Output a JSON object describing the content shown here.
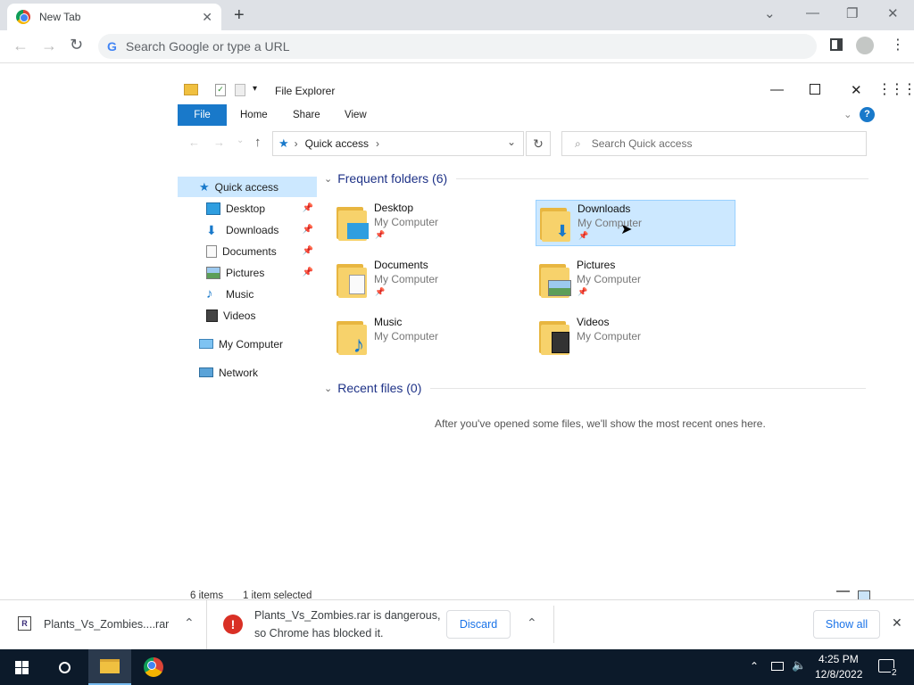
{
  "browser": {
    "tab_title": "New Tab",
    "omnibox_placeholder": "Search Google or type a URL",
    "icons": [
      "chrome-icon",
      "close-icon",
      "new-tab-icon",
      "back-icon",
      "forward-icon",
      "reload-icon",
      "google-icon",
      "sidepanel-icon",
      "profile-icon",
      "menu-icon"
    ]
  },
  "explorer": {
    "title": "File Explorer",
    "ribbon": {
      "file": "File",
      "home": "Home",
      "share": "Share",
      "view": "View"
    },
    "address": {
      "crumb": "Quick access"
    },
    "search_placeholder": "Search Quick access",
    "nav": [
      {
        "label": "Quick access",
        "pinned": false,
        "icon": "star-icon"
      },
      {
        "label": "Desktop",
        "pinned": true,
        "icon": "desktop-icon"
      },
      {
        "label": "Downloads",
        "pinned": true,
        "icon": "download-icon"
      },
      {
        "label": "Documents",
        "pinned": true,
        "icon": "document-icon"
      },
      {
        "label": "Pictures",
        "pinned": true,
        "icon": "picture-icon"
      },
      {
        "label": "Music",
        "pinned": false,
        "icon": "music-icon"
      },
      {
        "label": "Videos",
        "pinned": false,
        "icon": "video-icon"
      },
      {
        "label": "My Computer",
        "pinned": false,
        "icon": "computer-icon"
      },
      {
        "label": "Network",
        "pinned": false,
        "icon": "network-icon"
      }
    ],
    "frequent_header": "Frequent folders (6)",
    "folders": [
      {
        "name": "Desktop",
        "location": "My Computer",
        "pinned": true,
        "selected": false
      },
      {
        "name": "Downloads",
        "location": "My Computer",
        "pinned": true,
        "selected": true
      },
      {
        "name": "Documents",
        "location": "My Computer",
        "pinned": true,
        "selected": false
      },
      {
        "name": "Pictures",
        "location": "My Computer",
        "pinned": true,
        "selected": false
      },
      {
        "name": "Music",
        "location": "My Computer",
        "pinned": false,
        "selected": false
      },
      {
        "name": "Videos",
        "location": "My Computer",
        "pinned": false,
        "selected": false
      }
    ],
    "recent_header": "Recent files (0)",
    "recent_empty": "After you've opened some files, we'll show the most recent ones here.",
    "status": {
      "items": "6 items",
      "selected": "1 item selected"
    }
  },
  "download_bar": {
    "file": "Plants_Vs_Zombies....rar",
    "warning_line1": "Plants_Vs_Zombies.rar is dangerous,",
    "warning_line2": "so Chrome has blocked it.",
    "discard": "Discard",
    "show_all": "Show all"
  },
  "taskbar": {
    "time": "4:25 PM",
    "date": "12/8/2022",
    "notifications": "2"
  },
  "colors": {
    "accent": "#1979ca",
    "selection": "#cce8ff",
    "danger": "#d93025",
    "taskbar": "#0c1a2a"
  }
}
